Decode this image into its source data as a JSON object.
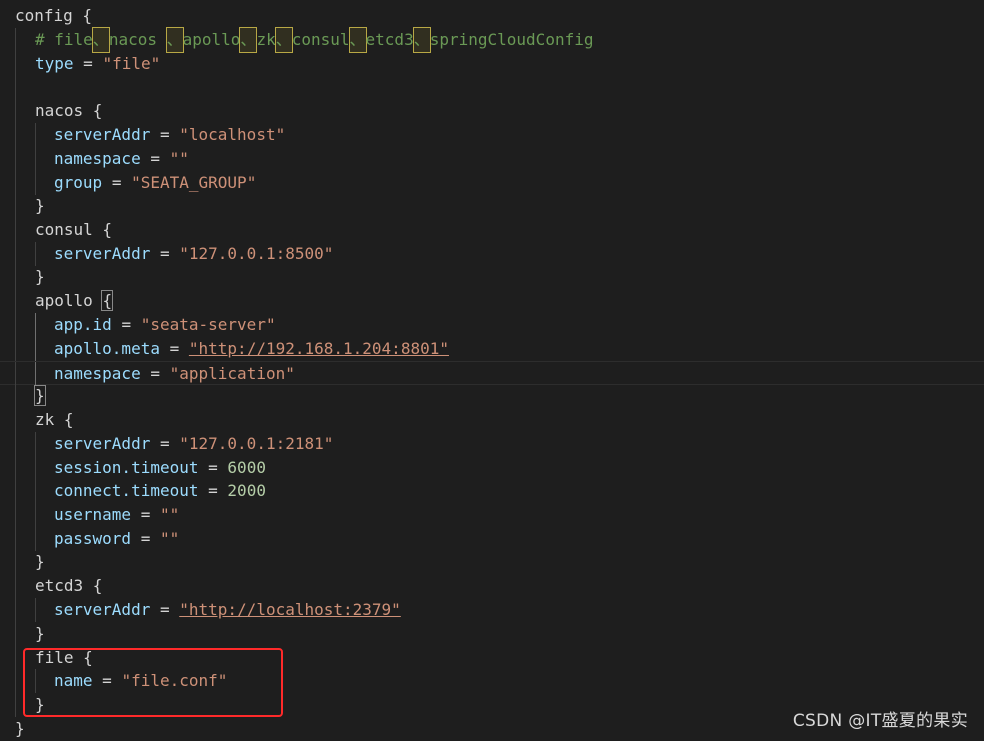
{
  "editor": {
    "lines": [
      {
        "id": "l1",
        "text": "config {"
      },
      {
        "id": "l2",
        "text": "# file、nacos 、apollo、zk、consul、etcd3、springCloudConfig"
      },
      {
        "id": "l3",
        "key": "type",
        "value": "\"file\""
      },
      {
        "id": "l4",
        "text": ""
      },
      {
        "id": "l5",
        "text": "nacos {"
      },
      {
        "id": "l6",
        "key": "serverAddr",
        "value": "\"localhost\""
      },
      {
        "id": "l7",
        "key": "namespace",
        "value": "\"\""
      },
      {
        "id": "l8",
        "key": "group",
        "value": "\"SEATA_GROUP\""
      },
      {
        "id": "l9",
        "text": "}"
      },
      {
        "id": "l10",
        "text": "consul {"
      },
      {
        "id": "l11",
        "key": "serverAddr",
        "value": "\"127.0.0.1:8500\""
      },
      {
        "id": "l12",
        "text": "}"
      },
      {
        "id": "l13",
        "text": "apollo {"
      },
      {
        "id": "l14",
        "key": "app.id",
        "value": "\"seata-server\""
      },
      {
        "id": "l15",
        "key": "apollo.meta",
        "value": "\"http://192.168.1.204:8801\""
      },
      {
        "id": "l16",
        "key": "namespace",
        "value": "\"application\""
      },
      {
        "id": "l17",
        "text": "}"
      },
      {
        "id": "l18",
        "text": "zk {"
      },
      {
        "id": "l19",
        "key": "serverAddr",
        "value": "\"127.0.0.1:2181\""
      },
      {
        "id": "l20",
        "key": "session.timeout",
        "value": "6000"
      },
      {
        "id": "l21",
        "key": "connect.timeout",
        "value": "2000"
      },
      {
        "id": "l22",
        "key": "username",
        "value": "\"\""
      },
      {
        "id": "l23",
        "key": "password",
        "value": "\"\""
      },
      {
        "id": "l24",
        "text": "}"
      },
      {
        "id": "l25",
        "text": "etcd3 {"
      },
      {
        "id": "l26",
        "key": "serverAddr",
        "value": "\"http://localhost:2379\""
      },
      {
        "id": "l27",
        "text": "}"
      },
      {
        "id": "l28",
        "text": "file {"
      },
      {
        "id": "l29",
        "key": "name",
        "value": "\"file.conf\""
      },
      {
        "id": "l30",
        "text": "}"
      },
      {
        "id": "l31",
        "text": "}"
      }
    ],
    "operator": "=",
    "comment_parts": [
      "# file",
      "、",
      "nacos ",
      "、",
      "apollo",
      "、",
      "zk",
      "、",
      "consul",
      "、",
      "etcd3",
      "、",
      "springCloudConfig"
    ]
  },
  "watermark": "CSDN @IT盛夏的果实",
  "colors": {
    "background": "#1e1e1e",
    "property": "#9cdcfe",
    "string": "#ce9178",
    "number": "#b5cea8",
    "comment": "#6a9955",
    "text": "#d4d4d4",
    "highlight_box": "#ff2a2a"
  }
}
